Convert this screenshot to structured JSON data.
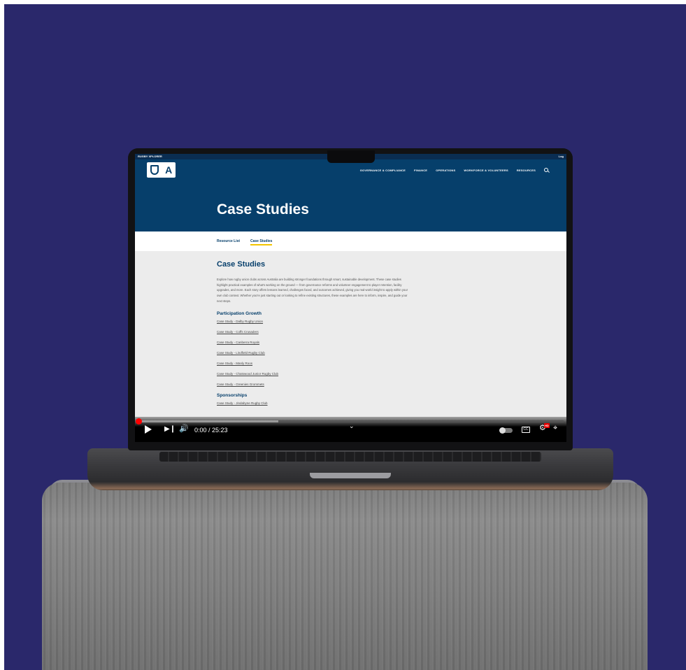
{
  "device": {
    "statusbar_left": "RUGBY XPLORER",
    "statusbar_right": "Log"
  },
  "site": {
    "logo_icon": "rugby-australia-logo",
    "nav": [
      "GOVERNANCE & COMPLIANCE",
      "FINANCE",
      "OPERATIONS",
      "WORKFORCE & VOLUNTEERS",
      "RESOURCES"
    ],
    "search_icon": "search-icon",
    "hero_title": "Case Studies",
    "tabs": [
      {
        "label": "Resource List",
        "active": false
      },
      {
        "label": "Case Studies",
        "active": true
      }
    ],
    "colors": {
      "brand": "#063f6b",
      "accent": "#f2c400",
      "background": "#2a286b"
    }
  },
  "main": {
    "heading": "Case Studies",
    "intro": "Explore how rugby union clubs across Australia are building stronger foundations through smart, sustainable development. These case studies highlight practical examples of what's working on the ground — from governance reforms and volunteer engagement to player retention, facility upgrades, and more. Each story offers lessons learned, challenges faced, and outcomes achieved, giving you real-world insight to apply within your own club context. Whether you're just starting out or looking to refine existing structures, these examples are here to inform, inspire, and guide your next steps.",
    "sections": [
      {
        "title": "Participation Growth",
        "links": [
          "Case Study - Dalby Rugby Union",
          "Case Study - Coffs Crusaders",
          "Case Study - Canberra Royals",
          "Case Study - Lindfield Rugby Club",
          "Case Study - Manly Roos",
          "Case Study - Chatswood Junior Rugby Club",
          "Case Study - Greenies Grommets"
        ]
      },
      {
        "title": "Sponsorships",
        "links": [
          "Case Study - Jindabyne Rugby Club"
        ]
      }
    ]
  },
  "player": {
    "time": "0:00 / 25:23",
    "progress_fraction": 0,
    "buffered_fraction": 0.33,
    "hd_badge": "HD",
    "cc_label": "CC"
  }
}
